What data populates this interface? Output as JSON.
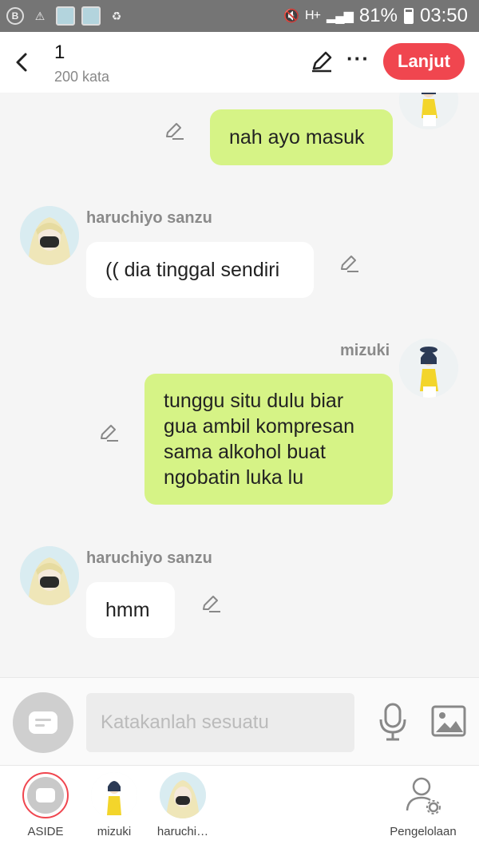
{
  "status_bar": {
    "battery": "81%",
    "time": "03:50",
    "network": "H+"
  },
  "header": {
    "title": "1",
    "word_count": "200 kata",
    "next_label": "Lanjut",
    "more_label": "···"
  },
  "messages": [
    {
      "sender": "",
      "side": "right",
      "text": "nah ayo masuk"
    },
    {
      "sender": "haruchiyo sanzu",
      "side": "left",
      "text": "(( dia tinggal sendiri"
    },
    {
      "sender": "mizuki",
      "side": "right",
      "lines": [
        "tunggu situ dulu biar",
        "gua ambil kompresan",
        "sama alkohol buat",
        "ngobatin luka lu"
      ]
    },
    {
      "sender": "haruchiyo sanzu",
      "side": "left",
      "text": "hmm"
    }
  ],
  "input": {
    "placeholder": "Katakanlah sesuatu"
  },
  "bottom_nav": [
    {
      "label": "ASIDE"
    },
    {
      "label": "mizuki"
    },
    {
      "label": "haruchi…"
    },
    {
      "label": "Pengelolaan"
    }
  ],
  "colors": {
    "accent": "#f0464f",
    "my_bubble": "#d6f386",
    "their_bubble": "#ffffff",
    "background": "#f5f5f5"
  }
}
